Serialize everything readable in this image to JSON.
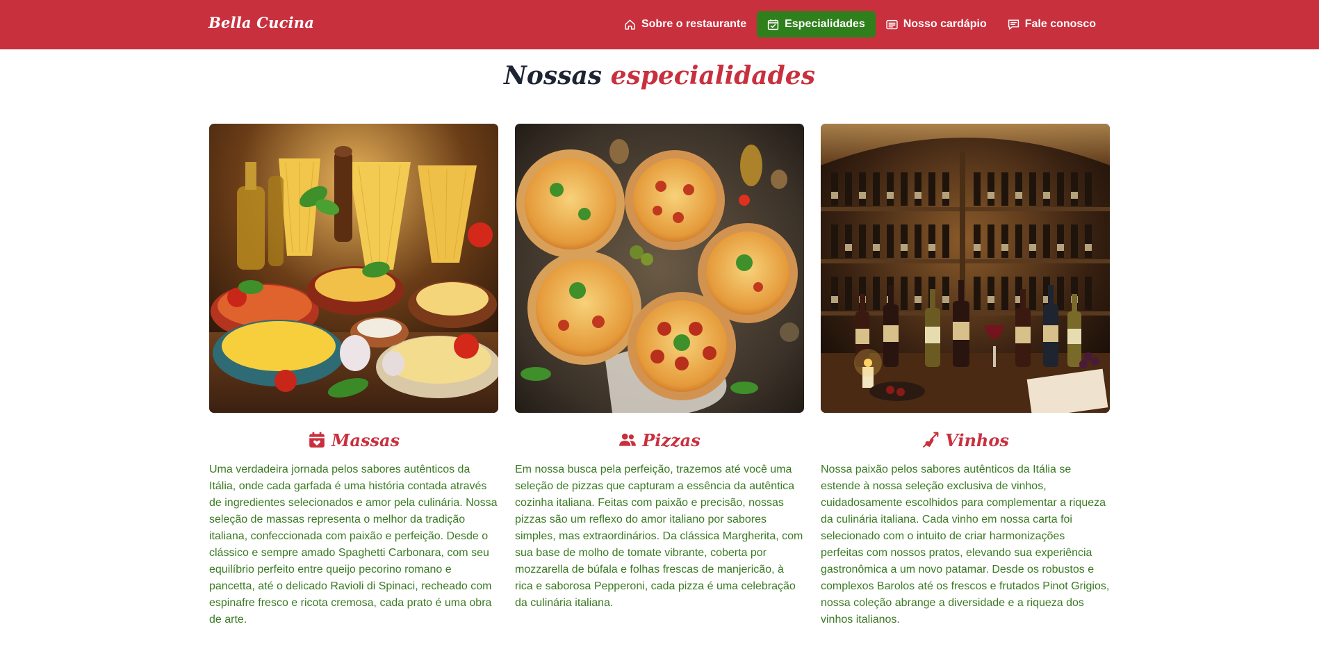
{
  "brand": "Bella Cucina",
  "nav": [
    {
      "label": "Sobre o restaurante",
      "icon": "home-icon",
      "active": false
    },
    {
      "label": "Especialidades",
      "icon": "calendar-check-icon",
      "active": true
    },
    {
      "label": "Nosso cardápio",
      "icon": "menu-card-icon",
      "active": false
    },
    {
      "label": "Fale conosco",
      "icon": "chat-icon",
      "active": false
    }
  ],
  "section": {
    "title_part1": "Nossas",
    "title_part2": "especialidades"
  },
  "cards": [
    {
      "title": "Massas",
      "icon": "calendar-heart-icon",
      "image": "pasta-spread-photo",
      "text": "Uma verdadeira jornada pelos sabores autênticos da Itália, onde cada garfada é uma história contada através de ingredientes selecionados e amor pela culinária. Nossa seleção de massas representa o melhor da tradição italiana, confeccionada com paixão e perfeição. Desde o clássico e sempre amado Spaghetti Carbonara, com seu equilíbrio perfeito entre queijo pecorino romano e pancetta, até o delicado Ravioli di Spinaci, recheado com espinafre fresco e ricota cremosa, cada prato é uma obra de arte."
    },
    {
      "title": "Pizzas",
      "icon": "people-icon",
      "image": "pizzas-photo",
      "text": "Em nossa busca pela perfeição, trazemos até você uma seleção de pizzas que capturam a essência da autêntica cozinha italiana. Feitas com paixão e precisão, nossas pizzas são um reflexo do amor italiano por sabores simples, mas extraordinários. Da clássica Margherita, com sua base de molho de tomate vibrante, coberta por mozzarella de búfala e folhas frescas de manjericão, à rica e saborosa Pepperoni, cada pizza é uma celebração da culinária italiana."
    },
    {
      "title": "Vinhos",
      "icon": "arrow-heart-icon",
      "image": "wine-cellar-photo",
      "text": "Nossa paixão pelos sabores autênticos da Itália se estende à nossa seleção exclusiva de vinhos, cuidadosamente escolhidos para complementar a riqueza da culinária italiana. Cada vinho em nossa carta foi selecionado com o intuito de criar harmonizações perfeitas com nossos pratos, elevando sua experiência gastronômica a um novo patamar. Desde os robustos e complexos Barolos até os frescos e frutados Pinot Grigios, nossa coleção abrange a diversidade e a riqueza dos vinhos italianos."
    }
  ],
  "colors": {
    "primary": "#c9303e",
    "active_nav": "#2f7f1c",
    "body_text": "#3b7a23",
    "heading_dark": "#1d2434"
  }
}
